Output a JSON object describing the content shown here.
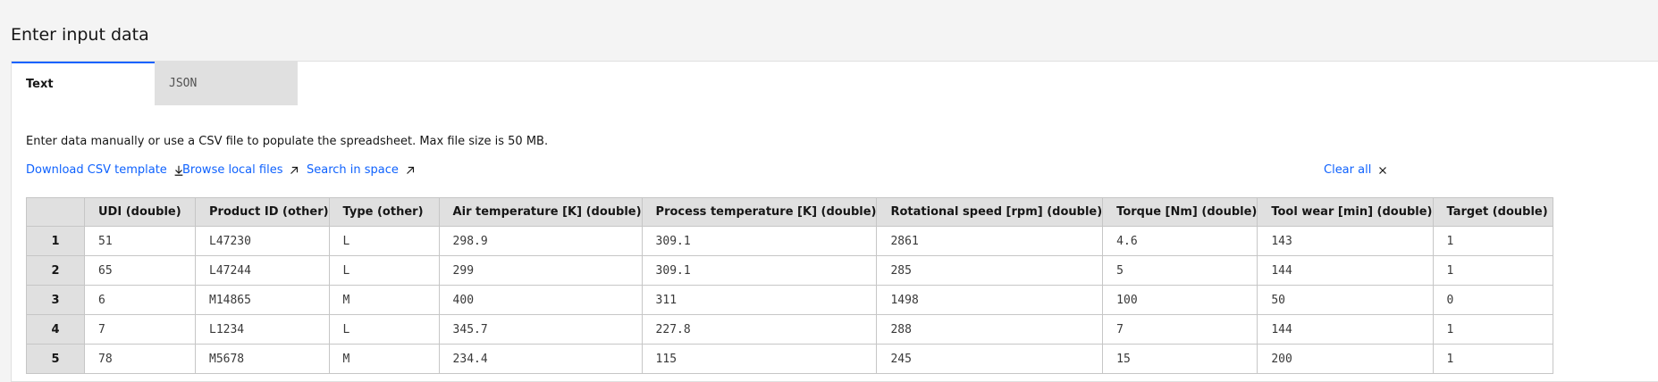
{
  "page": {
    "title": "Enter input data"
  },
  "tabs": [
    {
      "label": "Text",
      "active": true
    },
    {
      "label": "JSON",
      "active": false
    }
  ],
  "description": "Enter data manually or use a CSV file to populate the spreadsheet. Max file size is 50 MB.",
  "actions": {
    "download_csv": {
      "label": "Download CSV template",
      "icon": "download-icon"
    },
    "browse_local": {
      "label": "Browse local files",
      "icon": "external-link-icon"
    },
    "search_space": {
      "label": "Search in space",
      "icon": "external-link-icon"
    },
    "clear_all": {
      "label": "Clear all",
      "icon": "close-icon"
    }
  },
  "colors": {
    "link": "#0f62fe",
    "tab_active_border": "#0f62fe",
    "header_bg": "#e0e0e0"
  },
  "table": {
    "columns": [
      "UDI (double)",
      "Product ID (other)",
      "Type (other)",
      "Air temperature [K] (double)",
      "Process temperature [K] (double)",
      "Rotational speed [rpm] (double)",
      "Torque [Nm] (double)",
      "Tool wear [min] (double)",
      "Target (double)"
    ],
    "rows": [
      {
        "num": "1",
        "cells": [
          "51",
          "L47230",
          "L",
          "298.9",
          "309.1",
          "2861",
          "4.6",
          "143",
          "1"
        ]
      },
      {
        "num": "2",
        "cells": [
          "65",
          "L47244",
          "L",
          "299",
          "309.1",
          "285",
          "5",
          "144",
          "1"
        ]
      },
      {
        "num": "3",
        "cells": [
          "6",
          "M14865",
          "M",
          "400",
          "311",
          "1498",
          "100",
          "50",
          "0"
        ]
      },
      {
        "num": "4",
        "cells": [
          "7",
          "L1234",
          "L",
          "345.7",
          "227.8",
          "288",
          "7",
          "144",
          "1"
        ]
      },
      {
        "num": "5",
        "cells": [
          "78",
          "M5678",
          "M",
          "234.4",
          "115",
          "245",
          "15",
          "200",
          "1"
        ]
      }
    ]
  }
}
